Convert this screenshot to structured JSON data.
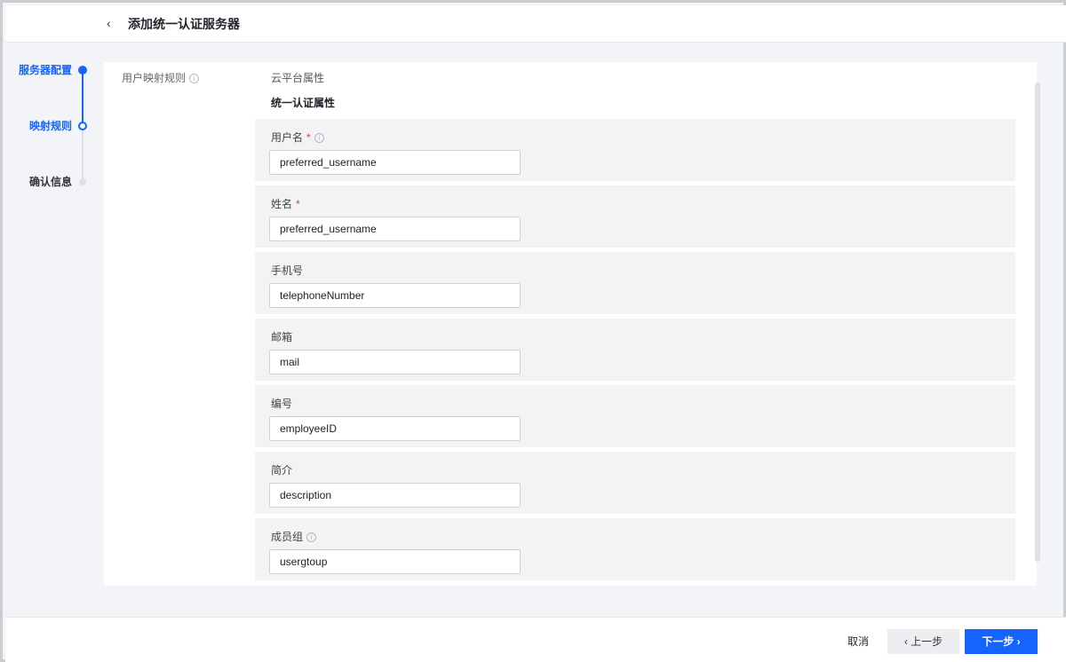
{
  "header": {
    "back_glyph": "‹",
    "title": "添加统一认证服务器"
  },
  "steps": [
    {
      "label": "服务器配置",
      "state": "completed"
    },
    {
      "label": "映射规则",
      "state": "current"
    },
    {
      "label": "确认信息",
      "state": "pending"
    }
  ],
  "panel": {
    "section_label": "用户映射规则",
    "info_glyph": "i",
    "col_cloud": "云平台属性",
    "col_auth": "统一认证属性",
    "fields": [
      {
        "label": "用户名",
        "required": "*",
        "value": "preferred_username"
      },
      {
        "label": "姓名",
        "required": "*",
        "value": "preferred_username"
      },
      {
        "label": "手机号",
        "value": "telephoneNumber"
      },
      {
        "label": "邮箱",
        "value": "mail"
      },
      {
        "label": "编号",
        "value": "employeeID"
      },
      {
        "label": "简介",
        "value": "description"
      },
      {
        "label": "成员组",
        "value": "usergtoup"
      }
    ]
  },
  "footer": {
    "cancel": "取消",
    "prev": "‹ 上一步",
    "next": "下一步 ›"
  },
  "colors": {
    "accent": "#1664ff",
    "required": "#e5383b",
    "row_bg": "#f2f3f5"
  }
}
